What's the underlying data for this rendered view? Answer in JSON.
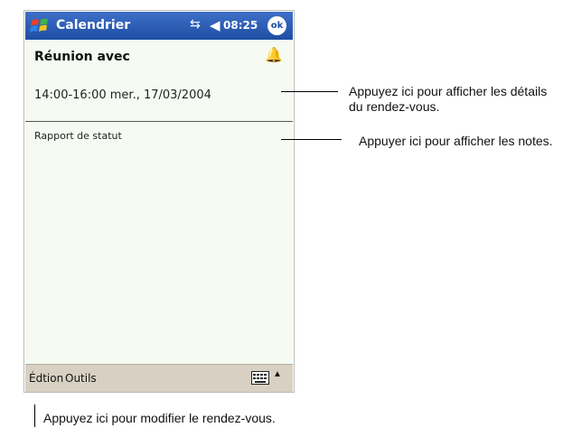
{
  "titlebar": {
    "app_title": "Calendrier",
    "clock": "08:25",
    "ok_label": "ok",
    "icons": [
      "windows-start-icon",
      "connectivity-icon",
      "volume-icon"
    ]
  },
  "appointment": {
    "subject": "Réunion avec",
    "datetime": "14:00-16:00 mer., 17/03/2004",
    "notes": "Rapport de statut"
  },
  "menubar": {
    "edit": "Édtion",
    "tools": "Outils"
  },
  "annotations": {
    "details": "Appuyez ici pour afficher les détails du rendez-vous.",
    "notes": "Appuyer ici pour afficher les notes.",
    "edit": "Appuyez ici pour modifier le rendez-vous."
  },
  "colors": {
    "titlebar": "#1d4ea3",
    "screen_bg": "#f5fbf3",
    "menubar": "#d8d0c2"
  }
}
